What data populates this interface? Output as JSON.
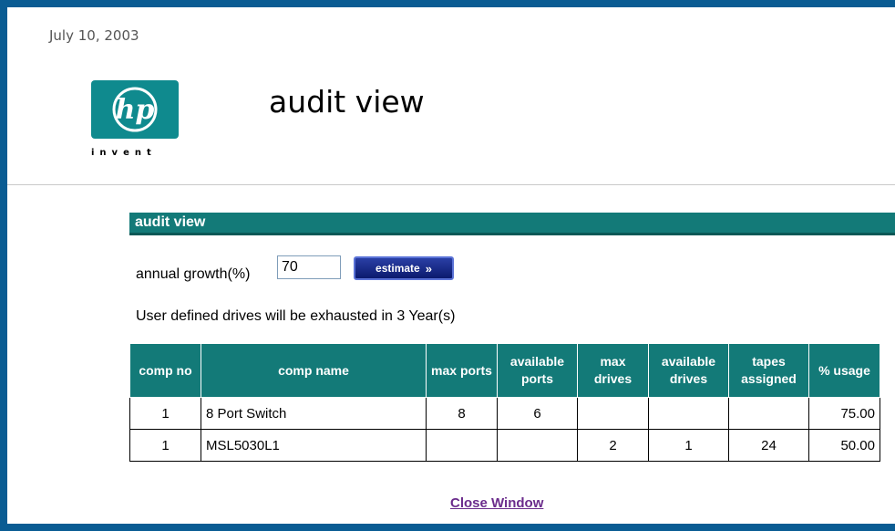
{
  "header": {
    "date": "July 10, 2003",
    "logo_text": "invent",
    "logo_mark": "hp",
    "title": "audit view"
  },
  "section": {
    "title": "audit view"
  },
  "growth": {
    "label": "annual growth(%)",
    "value": "70"
  },
  "estimate_button": {
    "label": "estimate",
    "chevron": "»"
  },
  "message": "User defined drives will be exhausted in 3 Year(s)",
  "table": {
    "headers": [
      "comp no",
      "comp name",
      "max ports",
      "available ports",
      "max drives",
      "available drives",
      "tapes assigned",
      "% usage"
    ],
    "rows": [
      [
        "1",
        "8 Port Switch",
        "8",
        "6",
        "",
        "",
        "",
        "75.00"
      ],
      [
        "1",
        "MSL5030L1",
        "",
        "",
        "2",
        "1",
        "24",
        "50.00"
      ]
    ]
  },
  "footer": {
    "close_link": "Close Window"
  },
  "colors": {
    "frame": "#0a5c93",
    "teal": "#137a78",
    "logo": "#0f8a8e",
    "button": "#0b1a6e",
    "link": "#6b2c8c"
  }
}
